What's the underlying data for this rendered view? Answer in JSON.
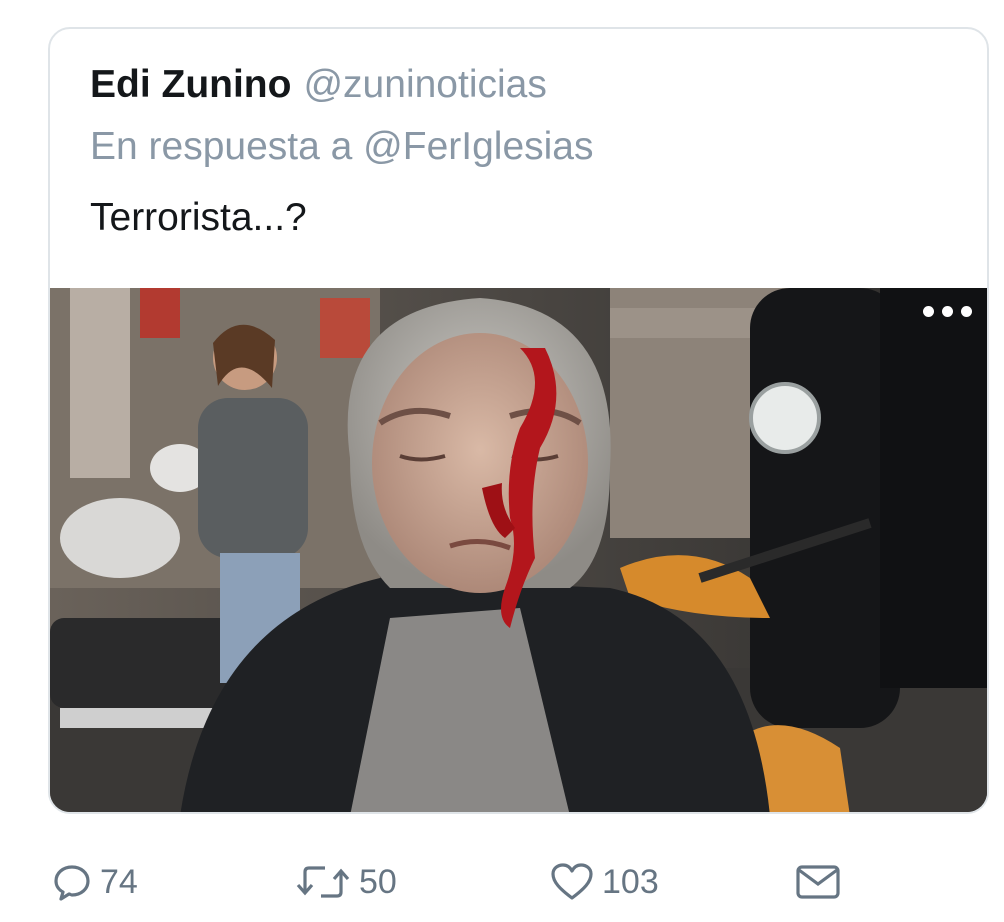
{
  "tweet": {
    "author_name": "Edi Zunino",
    "author_handle": "@zuninoticias",
    "reply_to": "En respuesta a @FerIglesias",
    "text": "Terrorista...?"
  },
  "media": {
    "more_icon": "ellipsis-icon"
  },
  "actions": {
    "reply": {
      "icon": "reply-icon",
      "count": "74"
    },
    "retweet": {
      "icon": "retweet-icon",
      "count": "50"
    },
    "like": {
      "icon": "heart-icon",
      "count": "103"
    },
    "message": {
      "icon": "envelope-icon"
    }
  },
  "colors": {
    "text_primary": "#14171a",
    "text_secondary": "#8a98a6",
    "icon_gray": "#667583",
    "border": "#dfe4e8"
  }
}
